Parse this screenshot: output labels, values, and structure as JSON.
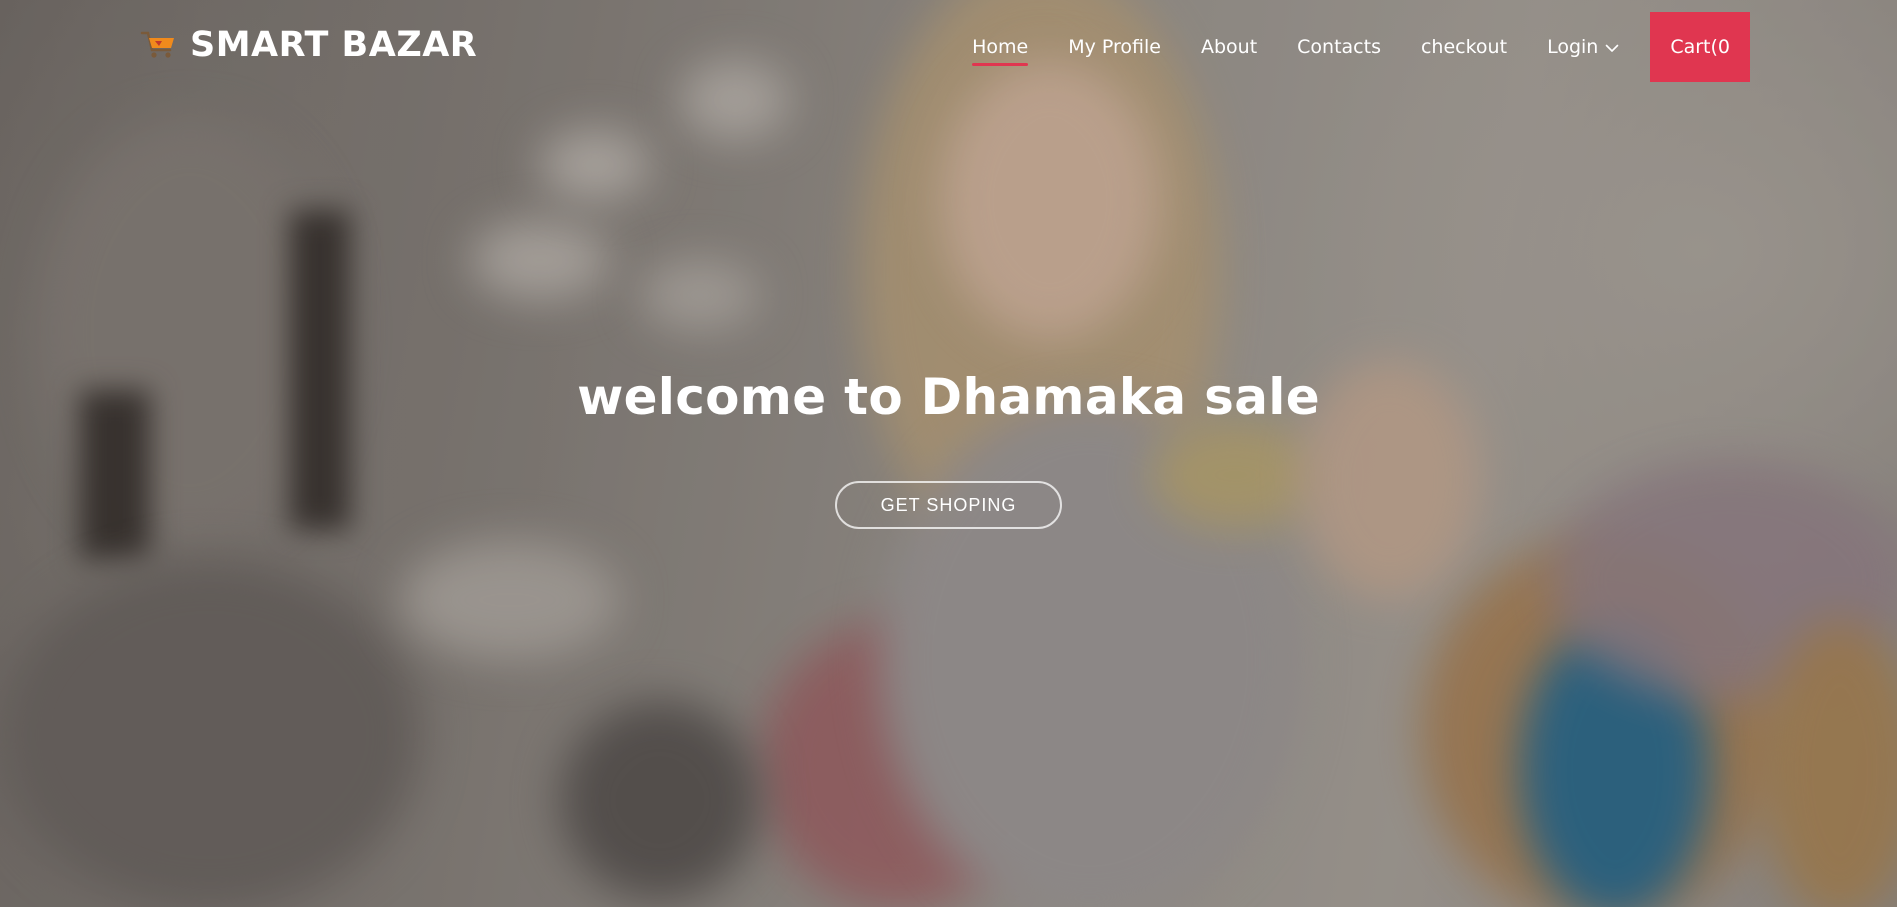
{
  "brand": {
    "name": "SMART BAZAR",
    "icon": "shopping-cart-logo-icon"
  },
  "nav": {
    "items": [
      {
        "label": "Home",
        "active": true
      },
      {
        "label": "My Profile",
        "active": false
      },
      {
        "label": "About",
        "active": false
      },
      {
        "label": "Contacts",
        "active": false
      },
      {
        "label": "checkout",
        "active": false
      },
      {
        "label": "Login",
        "active": false,
        "has_dropdown": true
      }
    ],
    "cart_label": "Cart(0"
  },
  "hero": {
    "title": "welcome to Dhamaka sale",
    "cta_label": "GET SHOPING",
    "background": "blurred-shopping-photo"
  },
  "colors": {
    "accent": "#e03650",
    "text": "#ffffff"
  }
}
